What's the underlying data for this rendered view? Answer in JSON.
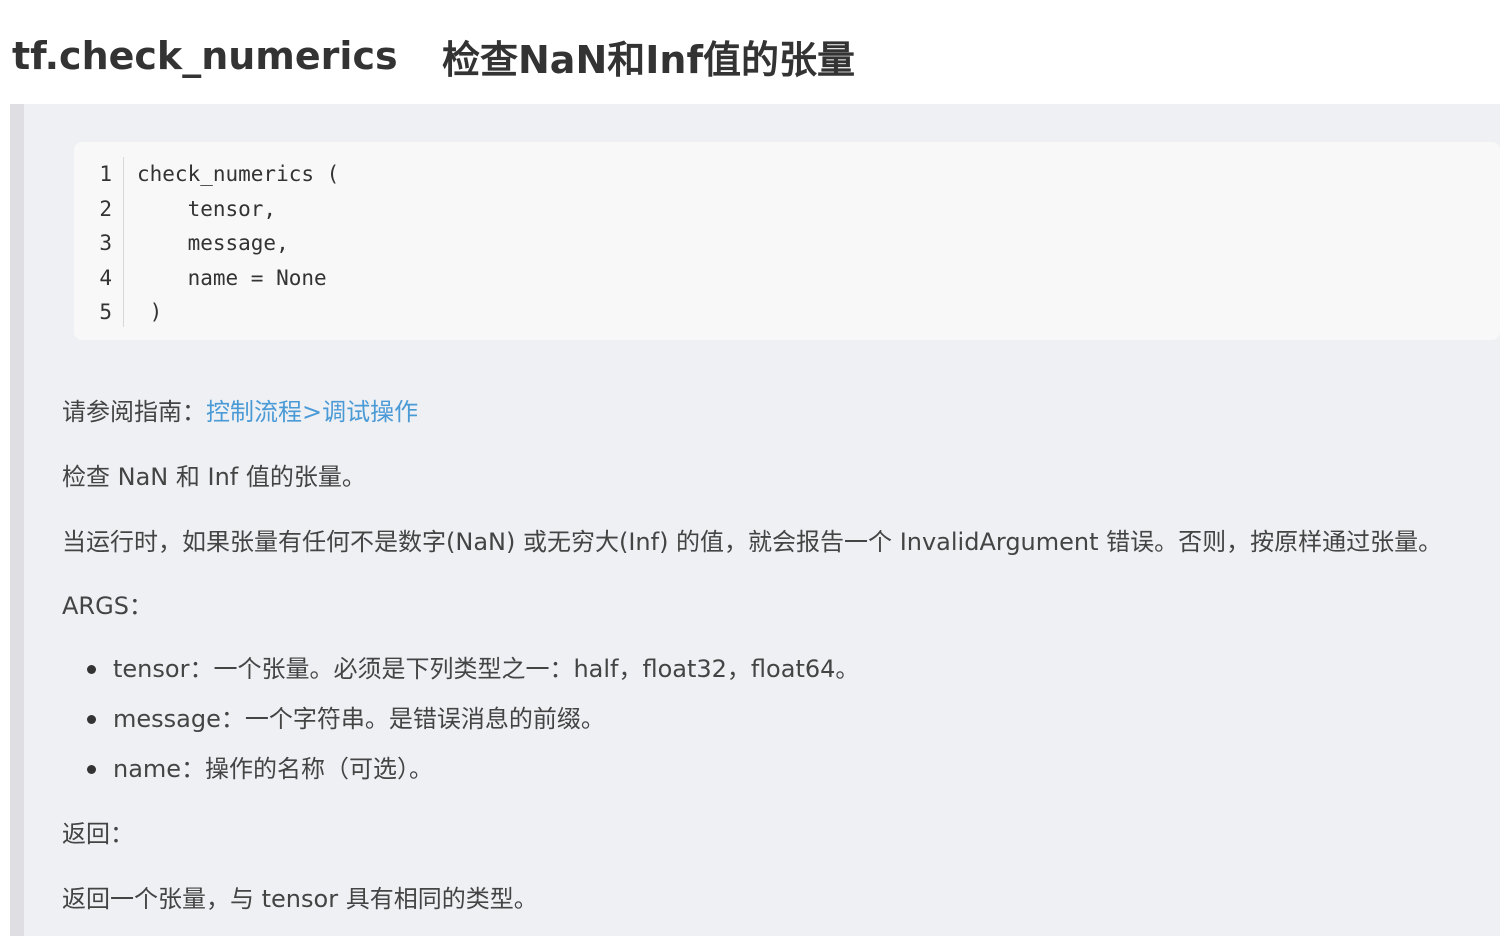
{
  "header": {
    "function_name": "tf.check_numerics",
    "title_zh": "检查NaN和Inf值的张量"
  },
  "code_block": {
    "line_numbers": [
      "1",
      "2",
      "3",
      "4",
      "5"
    ],
    "lines": [
      "check_numerics (",
      "    tensor,",
      "    message,",
      "    name = None",
      " )"
    ]
  },
  "guide": {
    "prefix": "请参阅指南：",
    "link_text": "控制流程>调试操作"
  },
  "description": "检查 NaN 和 Inf 值的张量。",
  "runtime_note": "当运行时，如果张量有任何不是数字(NaN) 或无穷大(Inf) 的值，就会报告一个 InvalidArgument 错误。否则，按原样通过张量。",
  "args_heading": "ARGS：",
  "args": [
    "tensor：一个张量。必须是下列类型之一：half，float32，float64。",
    "message：一个字符串。是错误消息的前缀。",
    "name：操作的名称（可选）。"
  ],
  "returns_heading": "返回：",
  "returns_text": "返回一个张量，与 tensor 具有相同的类型。",
  "colors": {
    "link": "#4a9ad6",
    "quote_background": "#eff0f4",
    "quote_border": "#dfdfe3",
    "code_background": "#f8f8f8"
  }
}
